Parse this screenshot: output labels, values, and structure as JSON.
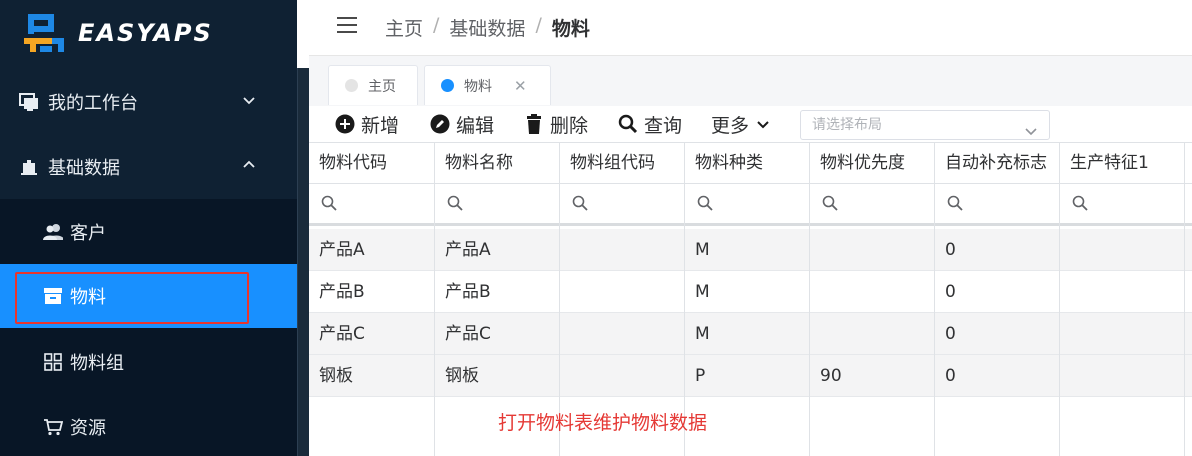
{
  "app": {
    "logo_text": "EASYAPS"
  },
  "sidebar": {
    "menus": [
      {
        "label": "我的工作台"
      },
      {
        "label": "基础数据"
      }
    ],
    "submenu": [
      {
        "label": "客户"
      },
      {
        "label": "物料"
      },
      {
        "label": "物料组"
      },
      {
        "label": "资源"
      }
    ]
  },
  "header": {
    "breadcrumb": [
      "主页",
      "基础数据",
      "物料"
    ]
  },
  "tabs": [
    {
      "label": "主页",
      "dot_color": "#e4e4e4"
    },
    {
      "label": "物料",
      "dot_color": "#1890ff"
    }
  ],
  "toolbar": {
    "add": "新增",
    "edit": "编辑",
    "delete": "删除",
    "query": "查询",
    "more": "更多",
    "layout_placeholder": "请选择布局"
  },
  "grid": {
    "columns": [
      "物料代码",
      "物料名称",
      "物料组代码",
      "物料种类",
      "物料优先度",
      "自动补充标志",
      "生产特征1"
    ],
    "rows": [
      [
        "产品A",
        "产品A",
        "",
        "M",
        "",
        "0",
        ""
      ],
      [
        "产品B",
        "产品B",
        "",
        "M",
        "",
        "0",
        ""
      ],
      [
        "产品C",
        "产品C",
        "",
        "M",
        "",
        "0",
        ""
      ],
      [
        "钢板",
        "钢板",
        "",
        "P",
        "90",
        "0",
        ""
      ]
    ]
  },
  "annotation": "打开物料表维护物料数据",
  "colors": {
    "sidebar_bg": "#0f2133",
    "active": "#1890ff",
    "highlight": "#e8352e",
    "annotation": "#e53935"
  }
}
